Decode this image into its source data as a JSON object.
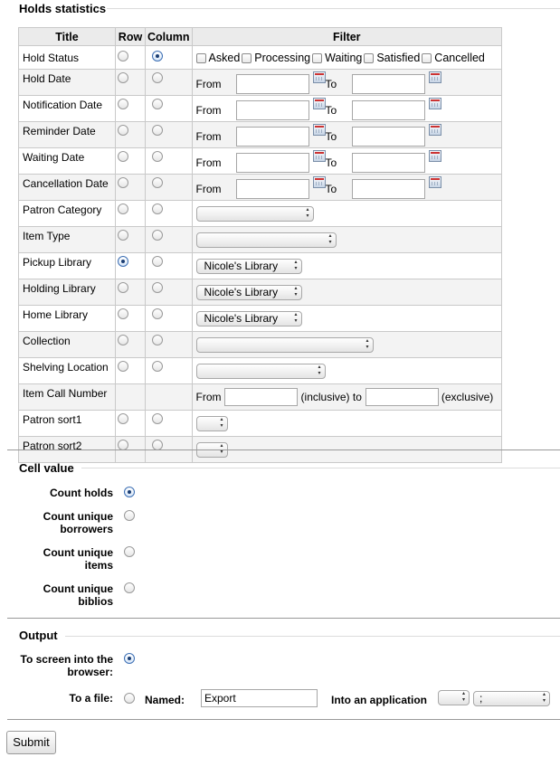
{
  "holds_stats": {
    "legend": "Holds statistics",
    "headers": {
      "title": "Title",
      "row": "Row",
      "column": "Column",
      "filter": "Filter"
    },
    "rows": [
      {
        "title": "Hold Status",
        "row_checked": false,
        "col_checked": true,
        "filter_type": "status"
      },
      {
        "title": "Hold Date",
        "row_checked": false,
        "col_checked": false,
        "filter_type": "date"
      },
      {
        "title": "Notification Date",
        "row_checked": false,
        "col_checked": false,
        "filter_type": "date"
      },
      {
        "title": "Reminder Date",
        "row_checked": false,
        "col_checked": false,
        "filter_type": "date"
      },
      {
        "title": "Waiting Date",
        "row_checked": false,
        "col_checked": false,
        "filter_type": "date"
      },
      {
        "title": "Cancellation Date",
        "row_checked": false,
        "col_checked": false,
        "filter_type": "date"
      },
      {
        "title": "Patron Category",
        "row_checked": false,
        "col_checked": false,
        "filter_type": "select",
        "select_value": "",
        "select_width": 130
      },
      {
        "title": "Item Type",
        "row_checked": false,
        "col_checked": false,
        "filter_type": "select",
        "select_value": "",
        "select_width": 155
      },
      {
        "title": "Pickup Library",
        "row_checked": true,
        "col_checked": false,
        "filter_type": "select",
        "select_value": "Nicole's Library",
        "select_width": 117
      },
      {
        "title": "Holding Library",
        "row_checked": false,
        "col_checked": false,
        "filter_type": "select",
        "select_value": "Nicole's Library",
        "select_width": 117
      },
      {
        "title": "Home Library",
        "row_checked": false,
        "col_checked": false,
        "filter_type": "select",
        "select_value": "Nicole's Library",
        "select_width": 117
      },
      {
        "title": "Collection",
        "row_checked": false,
        "col_checked": false,
        "filter_type": "select",
        "select_value": "",
        "select_width": 196
      },
      {
        "title": "Shelving Location",
        "row_checked": false,
        "col_checked": false,
        "filter_type": "select",
        "select_value": "",
        "select_width": 143
      },
      {
        "title": "Item Call Number",
        "row_checked": null,
        "col_checked": null,
        "filter_type": "callnumber"
      },
      {
        "title": "Patron sort1",
        "row_checked": false,
        "col_checked": false,
        "filter_type": "select",
        "select_value": "",
        "select_width": 35
      },
      {
        "title": "Patron sort2",
        "row_checked": false,
        "col_checked": false,
        "filter_type": "select",
        "select_value": "",
        "select_width": 35
      }
    ],
    "status_options": [
      "Asked",
      "Processing",
      "Waiting",
      "Satisfied",
      "Cancelled"
    ],
    "from_label": "From",
    "to_label": "To",
    "inclusive_to_label": "(inclusive) to",
    "exclusive_label": "(exclusive)"
  },
  "cell_value": {
    "legend": "Cell value",
    "options": [
      {
        "label": "Count holds",
        "checked": true
      },
      {
        "label": "Count unique borrowers",
        "checked": false
      },
      {
        "label": "Count unique items",
        "checked": false
      },
      {
        "label": "Count unique biblios",
        "checked": false
      }
    ]
  },
  "output": {
    "legend": "Output",
    "to_screen_label": "To screen into the browser:",
    "to_screen_checked": true,
    "to_file_label": "To a file:",
    "to_file_checked": false,
    "named_label": "Named:",
    "named_value": "Export",
    "into_app_label": "Into an application",
    "app_select_value": "",
    "separator_value": ";"
  },
  "submit_label": "Submit"
}
